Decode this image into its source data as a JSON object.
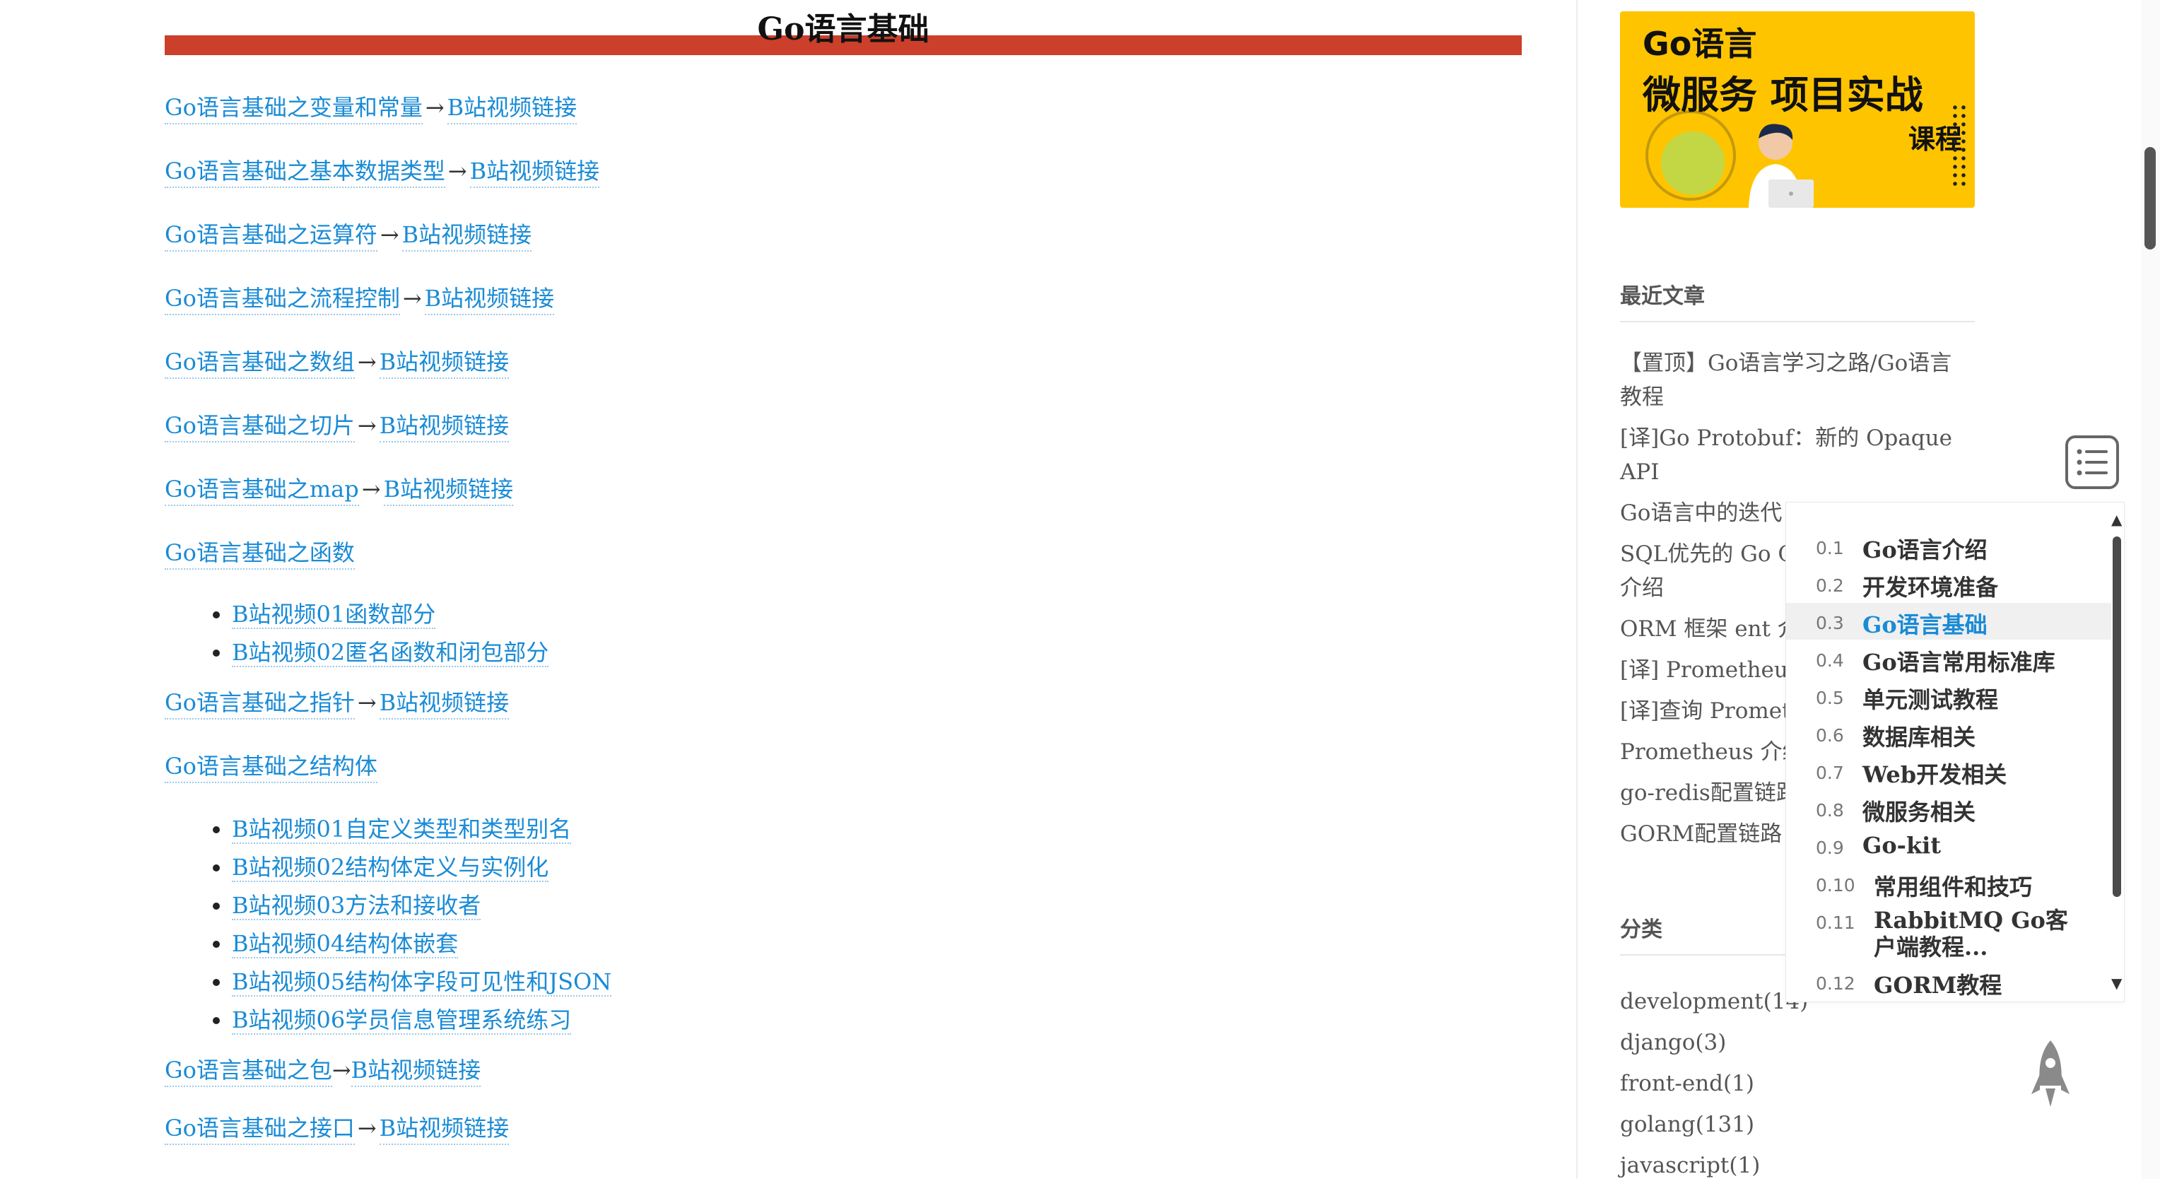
{
  "page_title": "Go语言基础",
  "articles": [
    {
      "link": "Go语言基础之变量和常量",
      "arrow": "→",
      "video": "B站视频链接"
    },
    {
      "link": "Go语言基础之基本数据类型",
      "arrow": "→",
      "video": "B站视频链接"
    },
    {
      "link": "Go语言基础之运算符",
      "arrow": "→",
      "video": "B站视频链接"
    },
    {
      "link": "Go语言基础之流程控制",
      "arrow": "→",
      "video": "B站视频链接"
    },
    {
      "link": "Go语言基础之数组",
      "arrow": "→",
      "video": "B站视频链接"
    },
    {
      "link": "Go语言基础之切片",
      "arrow": "→",
      "video": "B站视频链接"
    },
    {
      "link": "Go语言基础之map",
      "arrow": "→",
      "video": "B站视频链接"
    }
  ],
  "functions": {
    "link": "Go语言基础之函数",
    "videos": [
      "B站视频01函数部分",
      "B站视频02匿名函数和闭包部分"
    ]
  },
  "pointer": {
    "link": "Go语言基础之指针",
    "arrow": "→",
    "video": "B站视频链接"
  },
  "struct": {
    "link": "Go语言基础之结构体",
    "videos": [
      "B站视频01自定义类型和类型别名",
      "B站视频02结构体定义与实例化",
      "B站视频03方法和接收者",
      "B站视频04结构体嵌套",
      "B站视频05结构体字段可见性和JSON",
      "B站视频06学员信息管理系统练习"
    ]
  },
  "package": {
    "link": "Go语言基础之包",
    "arrow": "→",
    "video": "B站视频链接"
  },
  "cutoff": {
    "link": "Go语言基础之接口",
    "arrow": "→",
    "video": "B站视频链接"
  },
  "banner": {
    "line1": "Go语言",
    "line2": "微服务 项目实战",
    "line3": "课程"
  },
  "sidebar": {
    "recent_title": "最近文章",
    "recent": [
      "【置顶】Go语言学习之路/Go语言教程",
      "[译]Go Protobuf：新的 Opaque API",
      "Go语言中的迭代",
      "SQL优先的 Go C",
      "介绍",
      "ORM 框架 ent 介",
      "[译] Prometheus",
      "[译]查询 Promet",
      "Prometheus 介绍",
      "go-redis配置链路",
      "GORM配置链路"
    ],
    "categories_title": "分类",
    "categories": [
      "development(14)",
      "django(3)",
      "front-end(1)",
      "golang(131)",
      "javascript(1)"
    ]
  },
  "toc": [
    {
      "num": "0.1",
      "label": "Go语言介绍"
    },
    {
      "num": "0.2",
      "label": "开发环境准备"
    },
    {
      "num": "0.3",
      "label": "Go语言基础",
      "active": true
    },
    {
      "num": "0.4",
      "label": "Go语言常用标准库"
    },
    {
      "num": "0.5",
      "label": "单元测试教程"
    },
    {
      "num": "0.6",
      "label": "数据库相关"
    },
    {
      "num": "0.7",
      "label": "Web开发相关"
    },
    {
      "num": "0.8",
      "label": "微服务相关"
    },
    {
      "num": "0.9",
      "label": "Go-kit"
    },
    {
      "num": "0.10",
      "label": "常用组件和技巧"
    },
    {
      "num": "0.11",
      "label": "RabbitMQ Go客户端教程..."
    },
    {
      "num": "0.12",
      "label": "GORM教程"
    }
  ],
  "colors": {
    "accent": "#1a8bd6",
    "title_bar": "#cc3f2a",
    "banner": "#ffc400"
  }
}
